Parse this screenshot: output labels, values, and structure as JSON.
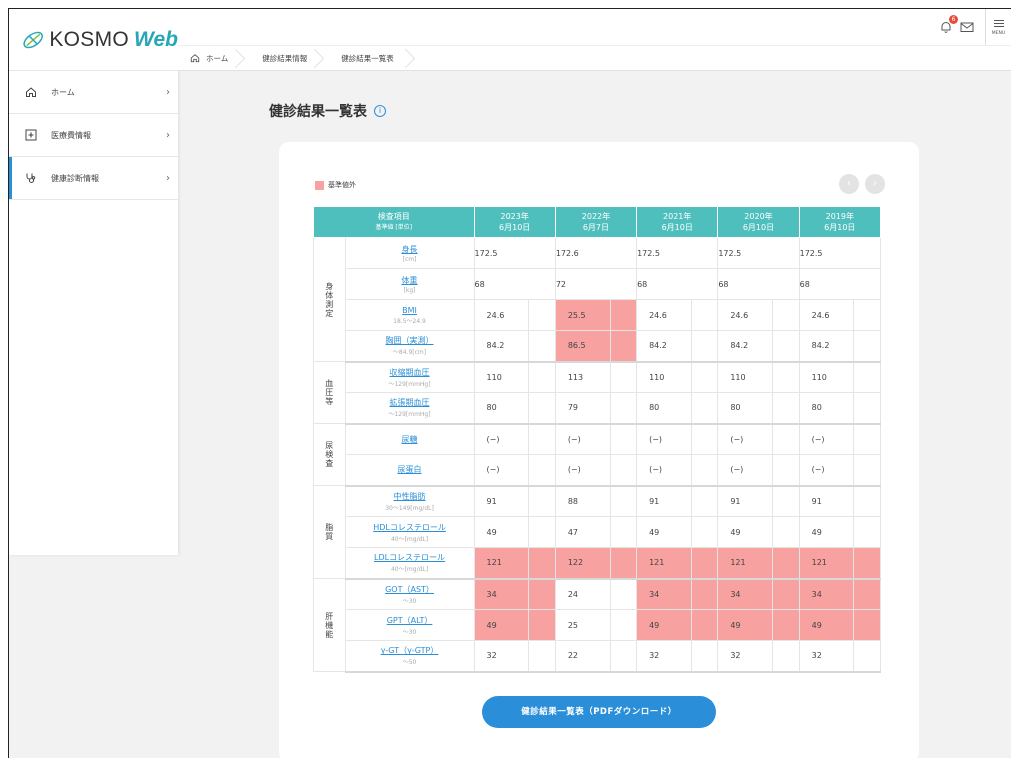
{
  "app": {
    "logo_main": "KOSMO",
    "logo_web": "Web"
  },
  "sidebar": {
    "items": [
      {
        "label": "ホーム",
        "icon": "home-icon"
      },
      {
        "label": "医療費情報",
        "icon": "plus-square-icon"
      },
      {
        "label": "健康診断情報",
        "icon": "stethoscope-icon",
        "active": true
      }
    ]
  },
  "topbar": {
    "badge_count": "6",
    "menu_label": "MENU"
  },
  "breadcrumb": [
    "ホーム",
    "健診結果情報",
    "健診結果一覧表"
  ],
  "page": {
    "title": "健診結果一覧表"
  },
  "legend": {
    "label": "基準値外",
    "color": "#f7a1a1"
  },
  "table": {
    "header_item": "検査項目",
    "header_item_sub": "基準値 [単位]",
    "years": [
      {
        "year": "2023年",
        "date": "6月10日"
      },
      {
        "year": "2022年",
        "date": "6月7日"
      },
      {
        "year": "2021年",
        "date": "6月10日"
      },
      {
        "year": "2020年",
        "date": "6月10日"
      },
      {
        "year": "2019年",
        "date": "6月10日"
      }
    ],
    "groups": [
      {
        "category": "身体測定",
        "rows": [
          {
            "name": "身長",
            "range": "[cm]",
            "values": [
              "172.5",
              "172.6",
              "172.5",
              "172.5",
              "172.5"
            ],
            "flags": [
              0,
              0,
              0,
              0,
              0
            ],
            "center": true
          },
          {
            "name": "体重",
            "range": "[kg]",
            "values": [
              "68",
              "72",
              "68",
              "68",
              "68"
            ],
            "flags": [
              0,
              0,
              0,
              0,
              0
            ],
            "center": true
          },
          {
            "name": "BMI",
            "range": "18.5〜24.9",
            "values": [
              "24.6",
              "25.5",
              "24.6",
              "24.6",
              "24.6"
            ],
            "flags": [
              0,
              1,
              0,
              0,
              0
            ]
          },
          {
            "name": "胸囲（実測）",
            "range": "〜84.9[cm]",
            "values": [
              "84.2",
              "86.5",
              "84.2",
              "84.2",
              "84.2"
            ],
            "flags": [
              0,
              1,
              0,
              0,
              0
            ]
          }
        ]
      },
      {
        "category": "血圧等",
        "rows": [
          {
            "name": "収縮期血圧",
            "range": "〜129[mmHg]",
            "values": [
              "110",
              "113",
              "110",
              "110",
              "110"
            ],
            "flags": [
              0,
              0,
              0,
              0,
              0
            ]
          },
          {
            "name": "拡張期血圧",
            "range": "〜129[mmHg]",
            "values": [
              "80",
              "79",
              "80",
              "80",
              "80"
            ],
            "flags": [
              0,
              0,
              0,
              0,
              0
            ]
          }
        ]
      },
      {
        "category": "尿検査",
        "rows": [
          {
            "name": "尿糖",
            "range": "",
            "values": [
              "(−)",
              "(−)",
              "(−)",
              "(−)",
              "(−)"
            ],
            "flags": [
              0,
              0,
              0,
              0,
              0
            ]
          },
          {
            "name": "尿蛋白",
            "range": "",
            "values": [
              "(−)",
              "(−)",
              "(−)",
              "(−)",
              "(−)"
            ],
            "flags": [
              0,
              0,
              0,
              0,
              0
            ]
          }
        ]
      },
      {
        "category": "脂質",
        "rows": [
          {
            "name": "中性脂肪",
            "range": "30〜149[mg/dL]",
            "values": [
              "91",
              "88",
              "91",
              "91",
              "91"
            ],
            "flags": [
              0,
              0,
              0,
              0,
              0
            ]
          },
          {
            "name": "HDLコレステロール",
            "range": "40〜[mg/dL]",
            "values": [
              "49",
              "47",
              "49",
              "49",
              "49"
            ],
            "flags": [
              0,
              0,
              0,
              0,
              0
            ]
          },
          {
            "name": "LDLコレステロール",
            "range": "40〜[mg/dL]",
            "values": [
              "121",
              "122",
              "121",
              "121",
              "121"
            ],
            "flags": [
              1,
              1,
              1,
              1,
              1
            ]
          }
        ]
      },
      {
        "category": "肝機能",
        "rows": [
          {
            "name": "GOT（AST）",
            "range": "〜30",
            "values": [
              "34",
              "24",
              "34",
              "34",
              "34"
            ],
            "flags": [
              1,
              0,
              1,
              1,
              1
            ]
          },
          {
            "name": "GPT（ALT）",
            "range": "〜30",
            "values": [
              "49",
              "25",
              "49",
              "49",
              "49"
            ],
            "flags": [
              1,
              0,
              1,
              1,
              1
            ]
          },
          {
            "name": "γ-GT（γ-GTP）",
            "range": "〜50",
            "values": [
              "32",
              "22",
              "32",
              "32",
              "32"
            ],
            "flags": [
              0,
              0,
              0,
              0,
              0
            ]
          }
        ]
      }
    ]
  },
  "download_button": "健診結果一覧表（PDFダウンロード）"
}
